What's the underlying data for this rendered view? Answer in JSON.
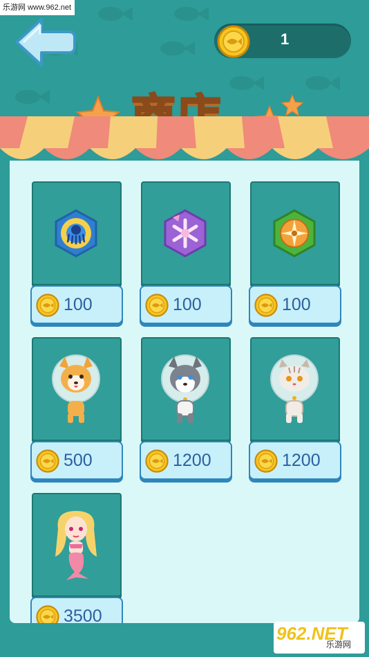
{
  "watermark": {
    "site_label": "乐游网 www.962.net"
  },
  "header": {
    "coin_count": "1",
    "title": "商店"
  },
  "shop": {
    "items": [
      {
        "kind": "octopus-badge",
        "price": "100"
      },
      {
        "kind": "snowflake-badge",
        "price": "100"
      },
      {
        "kind": "compass-badge",
        "price": "100"
      },
      {
        "kind": "corgi-astronaut",
        "price": "500"
      },
      {
        "kind": "husky-astronaut",
        "price": "1200"
      },
      {
        "kind": "cat-astronaut",
        "price": "1200"
      },
      {
        "kind": "mermaid",
        "price": "3500"
      }
    ]
  },
  "badge": {
    "brand_digits": "962",
    "brand_suffix": ".NET",
    "brand_cn": "乐游网"
  },
  "colors": {
    "background": "#2e9c98",
    "panel": "#dbf8f8",
    "card": "#319e99",
    "price_button": "#c7f0fb",
    "coin": "#f7c51e"
  }
}
